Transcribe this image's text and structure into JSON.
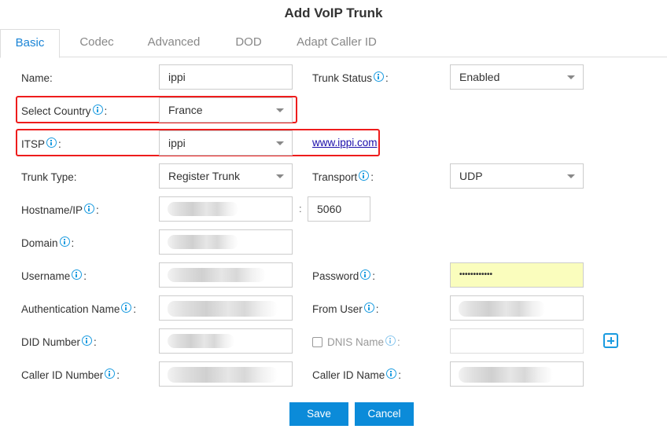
{
  "dialog": {
    "title": "Add VoIP Trunk"
  },
  "tabs": [
    {
      "label": "Basic",
      "active": true
    },
    {
      "label": "Codec",
      "active": false
    },
    {
      "label": "Advanced",
      "active": false
    },
    {
      "label": "DOD",
      "active": false
    },
    {
      "label": "Adapt Caller ID",
      "active": false
    }
  ],
  "form": {
    "name": {
      "label": "Name:",
      "value": "ippi"
    },
    "trunk_status": {
      "label": "Trunk Status",
      "value": "Enabled"
    },
    "select_country": {
      "label": "Select Country",
      "value": "France"
    },
    "itsp": {
      "label": "ITSP",
      "value": "ippi",
      "link": "www.ippi.com"
    },
    "trunk_type": {
      "label": "Trunk Type:",
      "value": "Register Trunk"
    },
    "transport": {
      "label": "Transport",
      "value": "UDP"
    },
    "hostname": {
      "label": "Hostname/IP",
      "value": "",
      "port_separator": ":",
      "port": "5060"
    },
    "domain": {
      "label": "Domain",
      "value": ""
    },
    "username": {
      "label": "Username",
      "value": ""
    },
    "password": {
      "label": "Password",
      "value": "••••••••••••"
    },
    "auth_name": {
      "label": "Authentication Name",
      "value": ""
    },
    "from_user": {
      "label": "From User",
      "value": ""
    },
    "did_number": {
      "label": "DID Number",
      "value": ""
    },
    "dnis_name": {
      "label": "DNIS Name",
      "value": "",
      "checked": false
    },
    "caller_id_number": {
      "label": "Caller ID Number",
      "value": ""
    },
    "caller_id_name": {
      "label": "Caller ID Name",
      "value": ""
    }
  },
  "colon": ":",
  "buttons": {
    "save": "Save",
    "cancel": "Cancel"
  },
  "colors": {
    "accent": "#0b8bd9",
    "highlight": "#ee1c1c",
    "info": "#1a9be0",
    "autofill": "#fafdbd"
  }
}
